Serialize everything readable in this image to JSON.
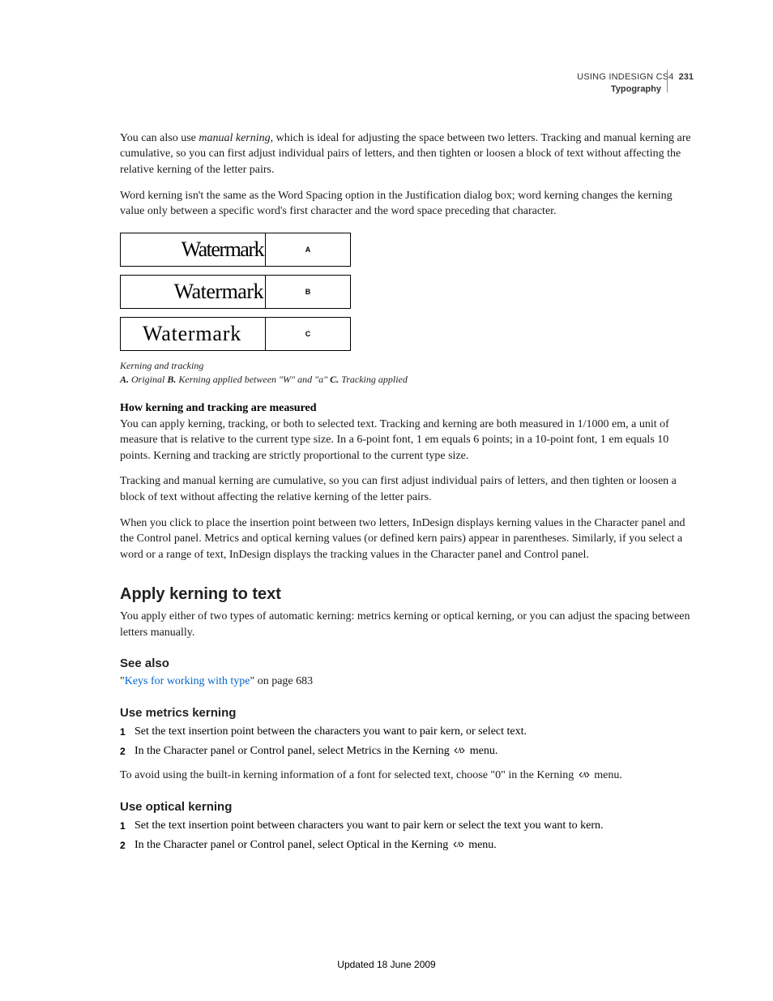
{
  "header": {
    "title": "USING INDESIGN CS4",
    "page_num": "231",
    "section": "Typography"
  },
  "p1_a": "You can also use ",
  "p1_b": "manual kerning,",
  "p1_c": " which is ideal for adjusting the space between two letters. Tracking and manual kerning are cumulative, so you can first adjust individual pairs of letters, and then tighten or loosen a block of text without affecting the relative kerning of the letter pairs.",
  "p2": "Word kerning isn't the same as the Word Spacing option in the Justification dialog box; word kerning changes the kerning value only between a specific word's first character and the word space preceding that character.",
  "figure": {
    "word": "Watermark",
    "labels": {
      "a": "A",
      "b": "B",
      "c": "C"
    },
    "caption_title": "Kerning and tracking",
    "caption_keys": {
      "a": "A.",
      "b": "B.",
      "c": "C."
    },
    "caption_vals": {
      "a": " Original  ",
      "b": " Kerning applied between \"W\" and \"a\"  ",
      "c": " Tracking applied"
    }
  },
  "subhead1": "How kerning and tracking are measured",
  "p3": "You can apply kerning, tracking, or both to selected text. Tracking and kerning are both measured in 1/1000 em, a unit of measure that is relative to the current type size. In a 6-point font, 1 em equals 6 points; in a 10-point font, 1 em equals 10 points. Kerning and tracking are strictly proportional to the current type size.",
  "p4": "Tracking and manual kerning are cumulative, so you can first adjust individual pairs of letters, and then tighten or loosen a block of text without affecting the relative kerning of the letter pairs.",
  "p5": "When you click to place the insertion point between two letters, InDesign displays kerning values in the Character panel and the Control panel. Metrics and optical kerning values (or defined kern pairs) appear in parentheses. Similarly, if you select a word or a range of text, InDesign displays the tracking values in the Character panel and Control panel.",
  "h2": "Apply kerning to text",
  "p6": "You apply either of two types of automatic kerning: metrics kerning or optical kerning, or you can adjust the spacing between letters manually.",
  "seealso_head": "See also",
  "seealso_q1": "\"",
  "seealso_link": "Keys for working with type",
  "seealso_q2": "\" on page 683",
  "h3a": "Use metrics kerning",
  "metrics_steps": {
    "s1": "Set the text insertion point between the characters you want to pair kern, or select text.",
    "s2a": "In the Character panel or Control panel, select Metrics in the Kerning ",
    "s2b": " menu."
  },
  "p7a": "To avoid using the built-in kerning information of a font for selected text, choose \"0\" in the Kerning ",
  "p7b": " menu.",
  "h3b": "Use optical kerning",
  "optical_steps": {
    "s1": "Set the text insertion point between characters you want to pair kern or select the text you want to kern.",
    "s2a": "In the Character panel or Control panel, select Optical in the Kerning ",
    "s2b": " menu."
  },
  "nums": {
    "n1": "1",
    "n2": "2"
  },
  "footer": "Updated 18 June 2009"
}
